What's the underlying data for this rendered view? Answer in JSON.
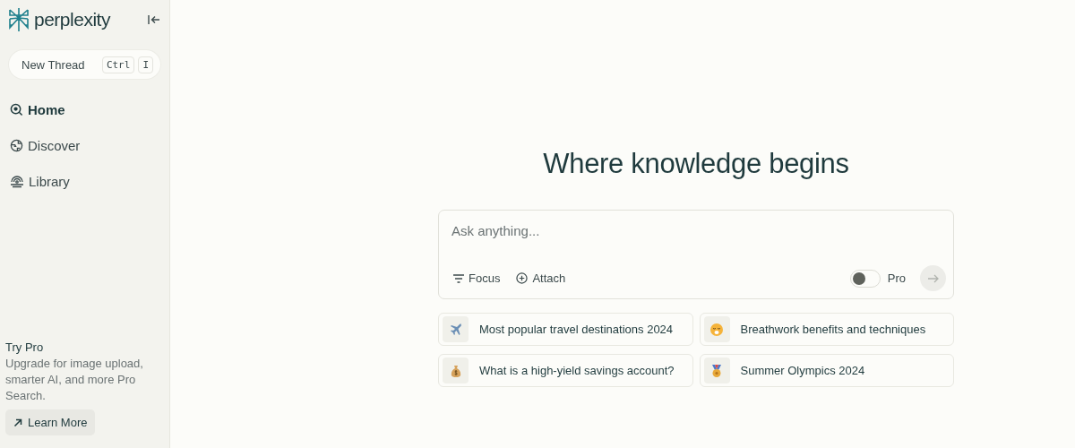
{
  "sidebar": {
    "brand": "perplexity",
    "new_thread": {
      "label": "New Thread",
      "keys": [
        "Ctrl",
        "I"
      ]
    },
    "nav": [
      {
        "label": "Home",
        "kind": "home",
        "selected": true
      },
      {
        "label": "Discover",
        "kind": "discover",
        "selected": false
      },
      {
        "label": "Library",
        "kind": "library",
        "selected": false
      }
    ],
    "promo": {
      "title": "Try Pro",
      "text": "Upgrade for image upload, smarter AI, and more Pro Search.",
      "button": "Learn More"
    }
  },
  "main": {
    "heading": "Where knowledge begins",
    "search": {
      "placeholder": "Ask anything...",
      "focus": "Focus",
      "attach": "Attach",
      "pro_label": "Pro",
      "pro_on": false
    },
    "suggestions": [
      {
        "text": "Most popular travel destinations 2024",
        "kind": "airplane"
      },
      {
        "text": "Breathwork benefits and techniques",
        "kind": "face"
      },
      {
        "text": "What is a high-yield savings account?",
        "kind": "money-bag"
      },
      {
        "text": "Summer Olympics 2024",
        "kind": "medal"
      }
    ]
  }
}
